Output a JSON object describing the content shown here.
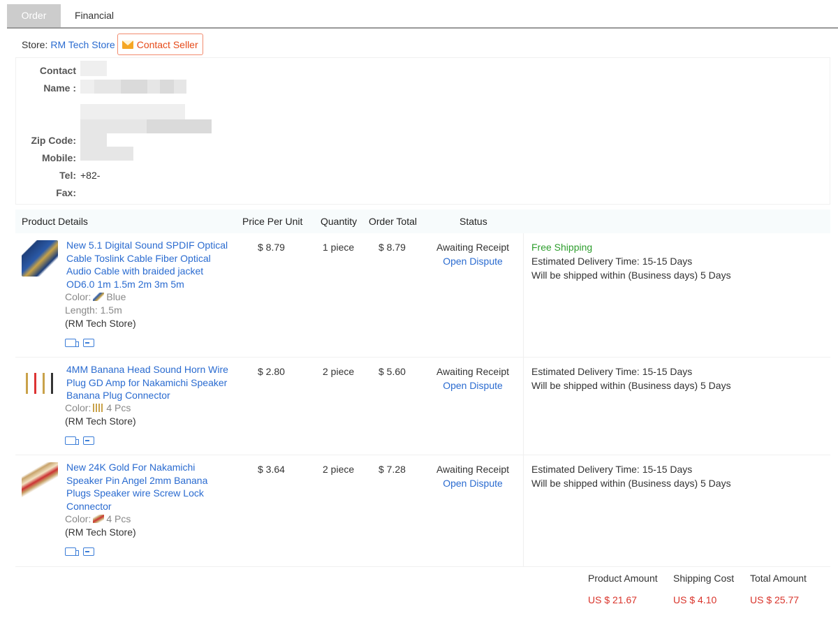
{
  "tabs": [
    {
      "label": "Order",
      "active": true
    },
    {
      "label": "Financial",
      "active": false
    }
  ],
  "store": {
    "label": "Store:",
    "name": "RM Tech Store",
    "contact_label": "Contact Seller"
  },
  "address": {
    "labels": {
      "contact_name_1": "Contact",
      "contact_name_2": "Name :",
      "zip": "Zip Code:",
      "mobile": "Mobile:",
      "tel": "Tel:",
      "fax": "Fax:"
    },
    "tel_value": "+82-",
    "fax_value": ""
  },
  "table": {
    "headers": {
      "product": "Product Details",
      "price": "Price Per Unit",
      "quantity": "Quantity",
      "total": "Order Total",
      "status": "Status"
    },
    "rows": [
      {
        "title": "New 5.1 Digital Sound SPDIF Optical Cable Toslink Cable Fiber Optical Audio Cable with braided jacket OD6.0 1m 1.5m 2m 3m 5m",
        "color_label": "Color:",
        "color_value": "Blue",
        "length_label": "Length:",
        "length_value": "1.5m",
        "store": "(RM Tech Store)",
        "price": "$ 8.79",
        "quantity": "1 piece",
        "total": "$ 8.79",
        "status": "Awaiting Receipt",
        "dispute": "Open Dispute",
        "free_shipping": "Free Shipping",
        "delivery": "Estimated Delivery Time: 15-15 Days",
        "ship_within": "Will be shipped within (Business days) 5 Days"
      },
      {
        "title": "4MM Banana Head Sound Horn Wire Plug GD Amp for Nakamichi Speaker Banana Plug Connector",
        "color_label": "Color:",
        "color_value": "4 Pcs",
        "store": "(RM Tech Store)",
        "price": "$ 2.80",
        "quantity": "2 piece",
        "total": "$ 5.60",
        "status": "Awaiting Receipt",
        "dispute": "Open Dispute",
        "delivery": "Estimated Delivery Time: 15-15 Days",
        "ship_within": "Will be shipped within (Business days) 5 Days"
      },
      {
        "title": "New 24K Gold For Nakamichi Speaker Pin Angel 2mm Banana Plugs Speaker wire Screw Lock Connector",
        "color_label": "Color:",
        "color_value": "4 Pcs",
        "store": "(RM Tech Store)",
        "price": "$ 3.64",
        "quantity": "2 piece",
        "total": "$ 7.28",
        "status": "Awaiting Receipt",
        "dispute": "Open Dispute",
        "delivery": "Estimated Delivery Time: 15-15 Days",
        "ship_within": "Will be shipped within (Business days) 5 Days"
      }
    ]
  },
  "totals": {
    "product_amount_label": "Product Amount",
    "product_amount": "US $ 21.67",
    "shipping_cost_label": "Shipping Cost",
    "shipping_cost": "US $ 4.10",
    "total_amount_label": "Total Amount",
    "total_amount": "US $ 25.77"
  },
  "colors": {
    "link": "#2a6bd0",
    "price_red": "#d9342b",
    "free_green": "#2e9e2e",
    "contact_orange": "#e64a19"
  },
  "icons": [
    "mail-icon",
    "delivery-truck-icon",
    "card-icon"
  ]
}
